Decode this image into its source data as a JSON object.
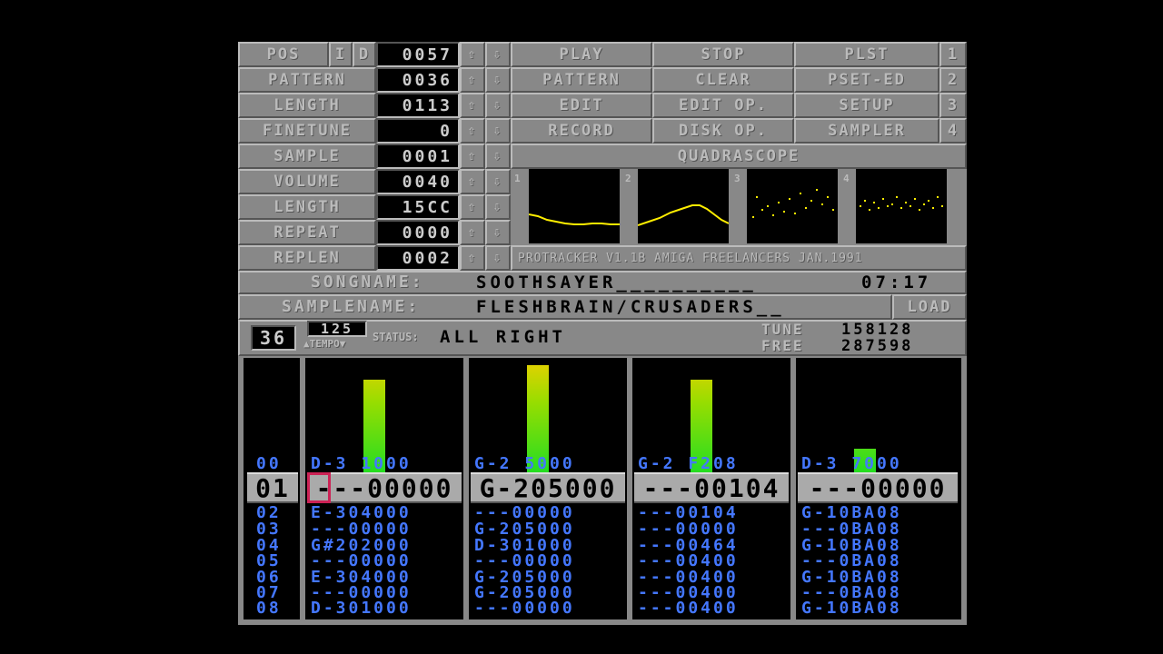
{
  "header": {
    "pos": {
      "label": "POS",
      "i": "I",
      "d": "D",
      "value": "0057"
    },
    "pattern": {
      "label": "PATTERN",
      "value": "0036"
    },
    "length": {
      "label": "LENGTH",
      "value": "0113"
    },
    "finetune": {
      "label": "FINETUNE",
      "value": "0"
    },
    "sample": {
      "label": "SAMPLE",
      "value": "0001"
    },
    "volume": {
      "label": "VOLUME",
      "value": "0040"
    },
    "slength": {
      "label": "LENGTH",
      "value": "15CC"
    },
    "repeat": {
      "label": "REPEAT",
      "value": "0000"
    },
    "replen": {
      "label": "REPLEN",
      "value": "0002"
    },
    "up_arrow": "⇧",
    "down_arrow": "⇩"
  },
  "buttons": {
    "play": "PLAY",
    "stop": "STOP",
    "plst": "PLST",
    "n1": "1",
    "pattern": "PATTERN",
    "clear": "CLEAR",
    "psetred": "PSET-ED",
    "n2": "2",
    "edit": "EDIT",
    "editop": "EDIT OP.",
    "setup": "SETUP",
    "n3": "3",
    "record": "RECORD",
    "diskop": "DISK OP.",
    "sampler": "SAMPLER",
    "n4": "4",
    "load": "LOAD"
  },
  "quadrascope": {
    "title": "QUADRASCOPE",
    "ch1": "1",
    "ch2": "2",
    "ch3": "3",
    "ch4": "4"
  },
  "credits": "PROTRACKER V1.1B    AMIGA FREELANCERS  JAN.1991",
  "song": {
    "label": "SONGNAME:",
    "name": "SOOTHSAYER__________",
    "time": "07:17"
  },
  "samplename": {
    "label": "SAMPLENAME:",
    "name": "FLESHBRAIN/CRUSADERS__"
  },
  "status": {
    "pattern_num": "36",
    "tempo_value": "125",
    "tempo_label": "TEMPO",
    "status_label": "STATUS:",
    "status_text": "ALL  RIGHT",
    "tune_label": "TUNE",
    "tune_value": "158128",
    "free_label": "FREE",
    "free_value": "287598"
  },
  "pattern_view": {
    "prev_row": {
      "num": "00",
      "ch": [
        "D-3 1000",
        "G-2 5000",
        "G-2 F208",
        "D-3 7000"
      ]
    },
    "current_row": {
      "num": "01",
      "ch": [
        "---00000",
        "G-205000",
        "---00104",
        "---00000"
      ]
    },
    "rows": [
      {
        "num": "02",
        "ch": [
          "E-304000",
          "---00000",
          "---00104",
          "G-10BA08"
        ]
      },
      {
        "num": "03",
        "ch": [
          "---00000",
          "G-205000",
          "---00000",
          "---0BA08"
        ]
      },
      {
        "num": "04",
        "ch": [
          "G#202000",
          "D-301000",
          "---00464",
          "G-10BA08"
        ]
      },
      {
        "num": "05",
        "ch": [
          "---00000",
          "---00000",
          "---00400",
          "---0BA08"
        ]
      },
      {
        "num": "06",
        "ch": [
          "E-304000",
          "G-205000",
          "---00400",
          "G-10BA08"
        ]
      },
      {
        "num": "07",
        "ch": [
          "---00000",
          "G-205000",
          "---00400",
          "---0BA08"
        ]
      },
      {
        "num": "08",
        "ch": [
          "D-301000",
          "---00000",
          "---00400",
          "G-10BA08"
        ]
      }
    ],
    "vu_levels": [
      0.52,
      0.6,
      0.52,
      0.14
    ]
  },
  "colors": {
    "panel": "#888888",
    "light": "#bbbbbb",
    "dark": "#555555",
    "note": "#4477ff",
    "scope": "#ffee00"
  }
}
